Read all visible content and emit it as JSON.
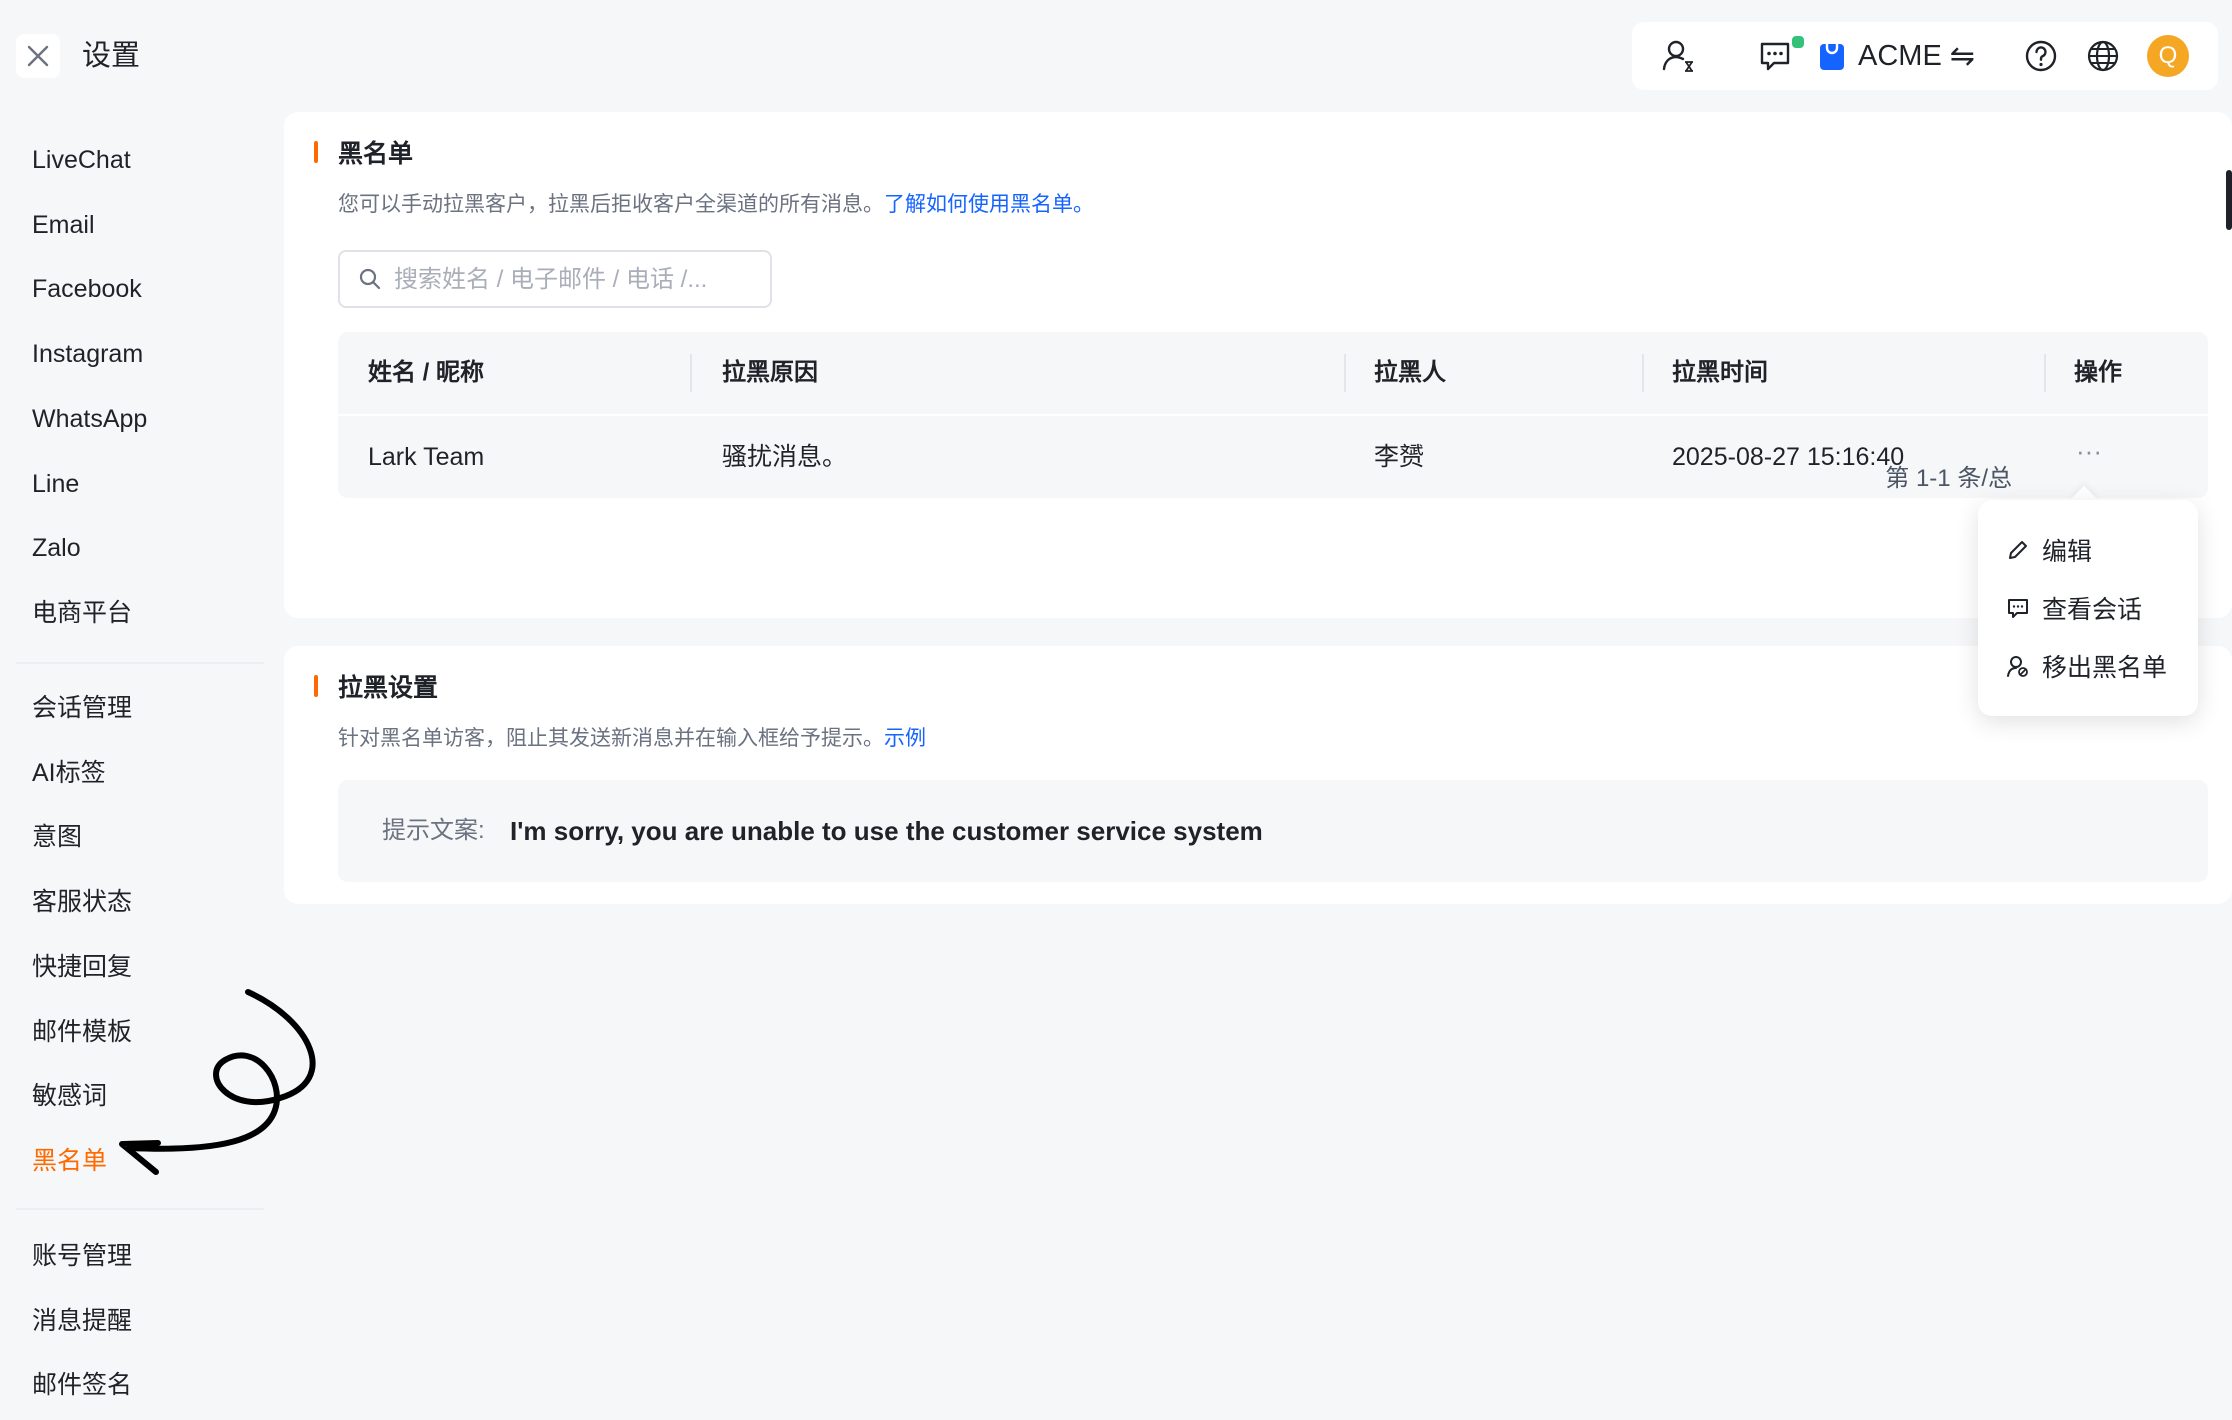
{
  "header": {
    "title": "设置"
  },
  "toolbar": {
    "workspace": "ACME",
    "avatar_letter": "Q",
    "swap_symbol": "⇋"
  },
  "sidebar": {
    "group1": [
      "LiveChat",
      "Email",
      "Facebook",
      "Instagram",
      "WhatsApp",
      "Line",
      "Zalo",
      "电商平台"
    ],
    "group2": [
      "会话管理",
      "AI标签",
      "意图",
      "客服状态",
      "快捷回复",
      "邮件模板",
      "敏感词",
      "黑名单"
    ],
    "group3": [
      "账号管理",
      "消息提醒",
      "邮件签名"
    ],
    "active": "黑名单"
  },
  "blacklist": {
    "title": "黑名单",
    "desc": "您可以手动拉黑客户，拉黑后拒收客户全渠道的所有消息。",
    "desc_link": "了解如何使用黑名单。",
    "search_placeholder": "搜索姓名 / 电子邮件 / 电话 /...",
    "columns": [
      "姓名 / 昵称",
      "拉黑原因",
      "拉黑人",
      "拉黑时间",
      "操作"
    ],
    "rows": [
      {
        "name": "Lark Team",
        "reason": "骚扰消息。",
        "by": "李赟",
        "time": "2025-08-27 15:16:40",
        "action": "···"
      }
    ],
    "pagination": "第 1-1 条/总"
  },
  "settings": {
    "title": "拉黑设置",
    "desc": "针对黑名单访客，阻止其发送新消息并在输入框给予提示。",
    "desc_link": "示例",
    "tip_label": "提示文案:",
    "tip_text": "I'm sorry, you are unable to use the customer service system"
  },
  "row_menu": {
    "items": [
      "编辑",
      "查看会话",
      "移出黑名单"
    ]
  },
  "colors": {
    "accent": "#ff6a00",
    "link": "#1664ff",
    "online": "#34c27a",
    "avatar": "#f5a623"
  }
}
